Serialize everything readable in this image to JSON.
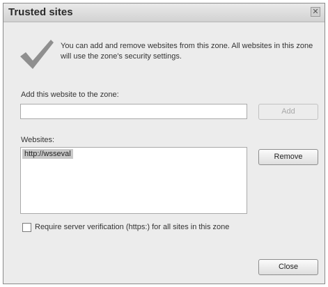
{
  "dialog": {
    "title": "Trusted sites",
    "close_glyph": "✕",
    "description": "You can add and remove websites from this zone. All websites in this zone will use the zone's security settings.",
    "add_label": "Add this website to the zone:",
    "add_input": {
      "value": "",
      "placeholder": ""
    },
    "add_button": "Add",
    "websites_label": "Websites:",
    "websites": [
      "http://wsseval"
    ],
    "remove_button": "Remove",
    "require_https": {
      "label": "Require server verification (https:) for all sites in this zone",
      "checked": false
    },
    "close_button": "Close"
  },
  "icons": {
    "check": "checkmark-icon"
  },
  "colors": {
    "checkmark": "#8f8f8f",
    "selection": "#c8c8c8"
  }
}
